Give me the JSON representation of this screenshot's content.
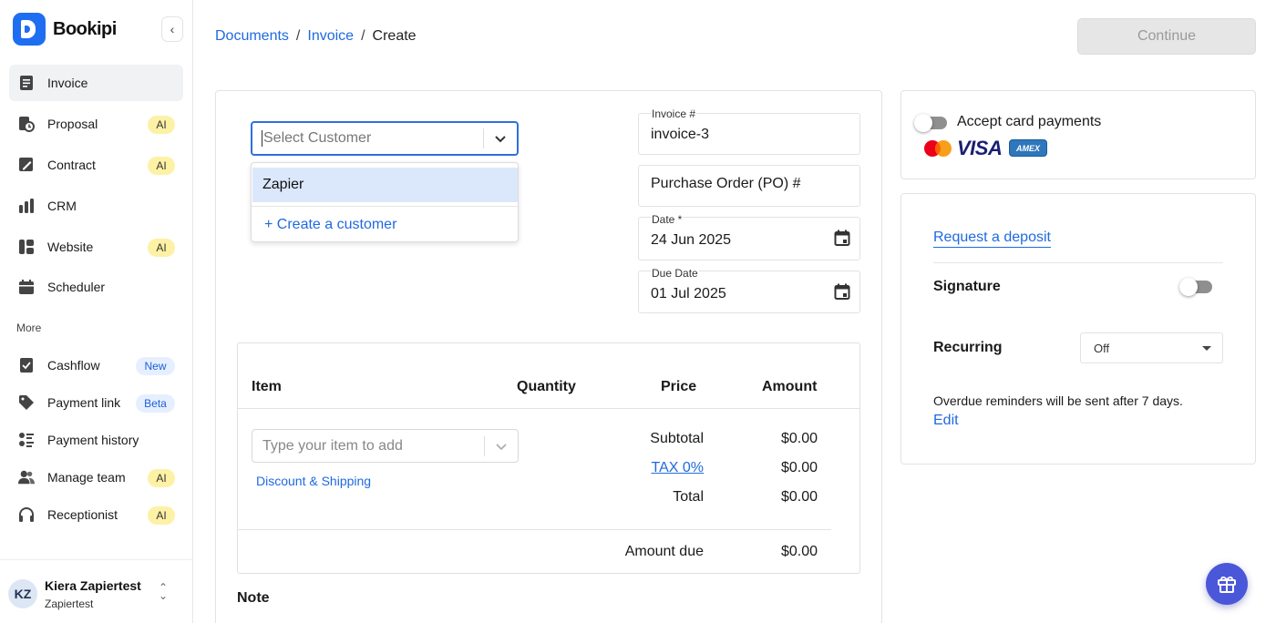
{
  "brand": {
    "name": "Bookipi"
  },
  "sidebar": {
    "items": [
      {
        "label": "Invoice",
        "badge": ""
      },
      {
        "label": "Proposal",
        "badge": "AI"
      },
      {
        "label": "Contract",
        "badge": "AI"
      },
      {
        "label": "CRM",
        "badge": ""
      },
      {
        "label": "Website",
        "badge": "AI"
      },
      {
        "label": "Scheduler",
        "badge": ""
      }
    ],
    "more_label": "More",
    "more_items": [
      {
        "label": "Cashflow",
        "badge": "New"
      },
      {
        "label": "Payment link",
        "badge": "Beta"
      },
      {
        "label": "Payment history",
        "badge": ""
      },
      {
        "label": "Manage team",
        "badge": "AI"
      },
      {
        "label": "Receptionist",
        "badge": "AI"
      }
    ],
    "user": {
      "initials": "KZ",
      "name": "Kiera Zapiertest",
      "org": "Zapiertest"
    }
  },
  "header": {
    "breadcrumb": [
      "Documents",
      "Invoice",
      "Create"
    ],
    "continue_label": "Continue"
  },
  "customer": {
    "placeholder": "Select Customer",
    "options": [
      "Zapier"
    ],
    "create_label": "+ Create a customer"
  },
  "fields": {
    "invoice_label": "Invoice #",
    "invoice_value": "invoice-3",
    "po_placeholder": "Purchase Order (PO) #",
    "date_label": "Date *",
    "date_value": "24 Jun 2025",
    "due_label": "Due Date",
    "due_value": "01 Jul 2025"
  },
  "items": {
    "headers": {
      "item": "Item",
      "quantity": "Quantity",
      "price": "Price",
      "amount": "Amount"
    },
    "input_placeholder": "Type your item to add",
    "discount_label": "Discount & Shipping",
    "subtotal_label": "Subtotal",
    "subtotal_value": "$0.00",
    "tax_label": "TAX 0%",
    "tax_value": "$0.00",
    "total_label": "Total",
    "total_value": "$0.00",
    "amount_due_label": "Amount due",
    "amount_due_value": "$0.00",
    "note_title": "Note"
  },
  "payments": {
    "accept_label": "Accept card payments",
    "accept_enabled": false,
    "card_brands": [
      "mastercard",
      "VISA",
      "AMEX"
    ]
  },
  "options": {
    "deposit_label": "Request a deposit",
    "signature_label": "Signature",
    "signature_enabled": false,
    "recurring_label": "Recurring",
    "recurring_value": "Off",
    "overdue_text": "Overdue reminders will be sent after 7 days.",
    "edit_label": "Edit"
  },
  "colors": {
    "accent": "#1f6ae0",
    "brand": "#1e6ef2",
    "gift": "#4b57d9",
    "ai_badge": "#fdf1a6"
  }
}
